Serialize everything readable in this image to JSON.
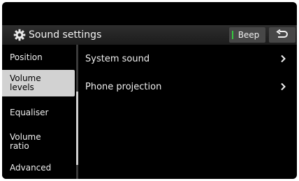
{
  "header": {
    "title": "Sound settings",
    "gear_icon": "gear-icon",
    "beep_label": "Beep",
    "beep_indicator_color": "#36c83e",
    "back_icon": "back-arrow-icon"
  },
  "sidebar": {
    "items": [
      {
        "label": "Position",
        "selected": false
      },
      {
        "label": "Volume\nlevels",
        "selected": true
      },
      {
        "label": "Equaliser",
        "selected": false
      },
      {
        "label": "Volume\nratio",
        "selected": false
      },
      {
        "label": "Advanced",
        "selected": false
      }
    ]
  },
  "main": {
    "items": [
      {
        "label": "System sound",
        "icon": "chevron-right-icon"
      },
      {
        "label": "Phone projection",
        "icon": "chevron-right-icon"
      }
    ]
  }
}
